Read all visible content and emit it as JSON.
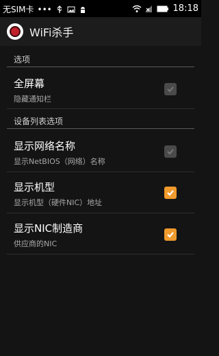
{
  "status_bar": {
    "carrier": "无SIM卡",
    "dots": "•••",
    "time": "18:18"
  },
  "action_bar": {
    "title": "WiFi杀手",
    "icon": "app-logo-icon"
  },
  "sections": [
    {
      "header": "选项",
      "items": [
        {
          "title": "全屏幕",
          "summary": "隐藏通知栏",
          "checked": true,
          "enabled": false
        }
      ]
    },
    {
      "header": "设备列表选项",
      "items": [
        {
          "title": "显示网络名称",
          "summary": "显示NetBIOS（网络）名称",
          "checked": true,
          "enabled": false
        },
        {
          "title": "显示机型",
          "summary": "显示机型（硬件NIC）地址",
          "checked": true,
          "enabled": true
        },
        {
          "title": "显示NIC制造商",
          "summary": "供应商的NIC",
          "checked": true,
          "enabled": true
        }
      ]
    }
  ],
  "colors": {
    "accent": "#f19a2d",
    "background": "#141414",
    "disabled_checkbox": "#4a4a4a"
  }
}
